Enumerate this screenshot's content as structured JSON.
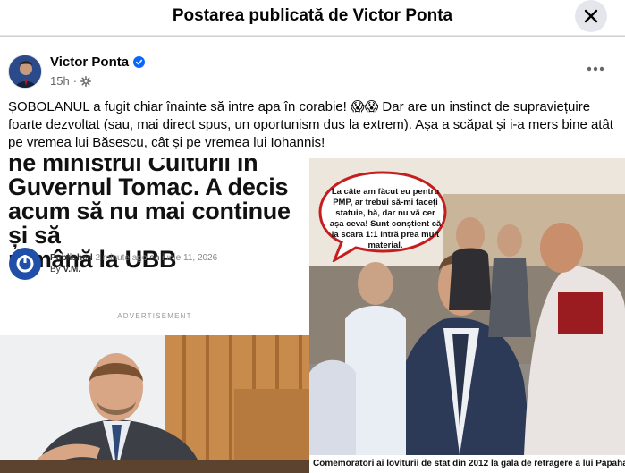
{
  "header": {
    "title": "Postarea publicată de Victor Ponta",
    "close_icon": "close-icon"
  },
  "post": {
    "author": "Victor Ponta",
    "verified_icon": "verified-badge-icon",
    "time": "15h",
    "separator": "·",
    "privacy_icon": "gear-icon",
    "more_icon": "more-options-icon",
    "text": "ȘOBOLANUL a fugit chiar înainte să intre apa în corabie! 😱😱 Dar are un instinct de supraviețuire foarte dezvoltat (sau, mai direct spus, un oportunism dus la extrem). Așa a scăpat și i-a mers bine atât pe vremea lui Băsescu, cât și pe vremea lui Iohannis!"
  },
  "media": {
    "left": {
      "headline_top": "ne ministrul Culturii în",
      "headline_line2": "Guvernul Tomac. A decis",
      "headline_line3": "acum să nu mai continue și să",
      "headline_line4": "rămână la UBB",
      "published_label": "Published",
      "published_ago": "2 minute ago",
      "published_on": "on",
      "published_date": "iunie 11, 2026",
      "by_label": "By",
      "by_author": "V.M.",
      "ad_label": "ADVERTISEMENT"
    },
    "right": {
      "speech_text": "La câte am făcut eu pentru PMP, ar trebui să-mi faceți statuie, bă, dar nu vă cer așa ceva! Sunt conștient că la scara 1:1 intră prea mult material.",
      "caption": "Comemoratori ai loviturii de stat din 2012 la gala de retragere a lui Papahagi din PMP"
    }
  },
  "colors": {
    "accent": "#0866ff",
    "text_primary": "#050505",
    "text_secondary": "#65676b",
    "close_bg": "#e4e6eb"
  }
}
